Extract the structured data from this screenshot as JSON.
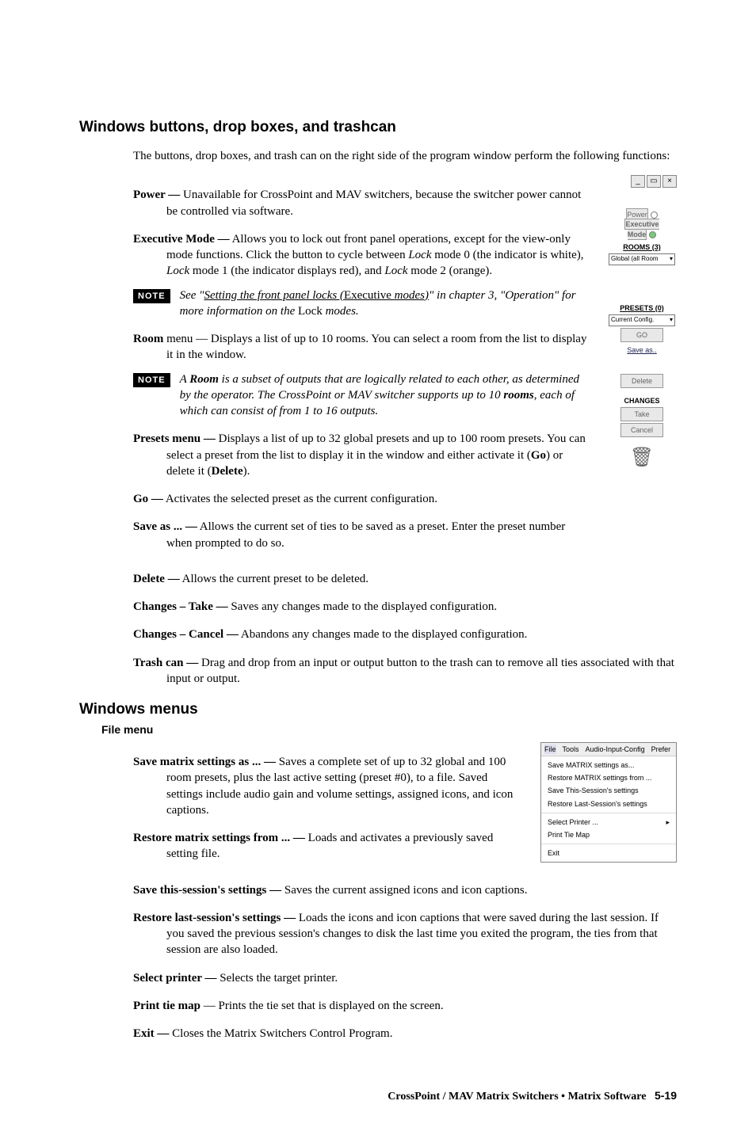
{
  "section1": {
    "heading": "Windows buttons, drop boxes, and trashcan",
    "intro": "The buttons, drop boxes, and trash can on the right side of the program window perform the following functions:",
    "power": {
      "term": "Power —",
      "desc": " Unavailable for CrossPoint and MAV switchers, because the switcher power cannot be controlled via software."
    },
    "exec": {
      "term": "Executive Mode —",
      "a": " Allows you to lock out front panel operations, except for the view-only mode functions.  Click the button to cycle between ",
      "b": "Lock",
      "c": " mode 0 (the indicator is white), ",
      "d": "Lock",
      "e": " mode 1 (the indicator displays red), and ",
      "f": "Lock",
      "g": " mode 2 (orange)."
    },
    "note1": {
      "tag": "NOTE",
      "a": "See \"",
      "link": "Setting the front panel locks (",
      "link_up": "Executive ",
      "link2": "modes)",
      "b": "\" in chapter 3, \"Operation\" for more information on the ",
      "c": "Lock ",
      "d": "modes."
    },
    "room": {
      "term": "Room",
      "a": " menu — Displays a list of up to 10 rooms.  You can select a room from the list to display it in the window."
    },
    "note2": {
      "tag": "NOTE",
      "a": "A ",
      "b": "Room",
      "c": " is a subset of outputs that are logically related to each other, as determined by the operator.  The CrossPoint or MAV switcher supports up to 10 ",
      "d": "rooms",
      "e": ", each of which can consist of from 1 to 16 outputs."
    },
    "presets": {
      "term": "Presets",
      "a": " menu —",
      "b": " Displays a list of up to 32 global presets and up to 100 room presets.  You can select a preset from the list to display it in the window and either activate it (",
      "c": "Go",
      "d": ") or delete it (",
      "e": "Delete",
      "f": ")."
    },
    "go": {
      "term": "Go —",
      "a": " Activates the selected preset as the current configuration."
    },
    "saveas": {
      "term": "Save as ... —",
      "a": " Allows the current set of ties to be saved as a preset.  Enter the preset number when prompted to do so."
    },
    "delete": {
      "term": "Delete —",
      "a": " Allows the current preset to be deleted."
    },
    "take": {
      "term": "Changes – ",
      "term2": "Take —",
      "a": " Saves any changes made to the displayed configuration."
    },
    "cancel": {
      "term": "Changes – ",
      "term2": "Cancel —",
      "a": " Abandons any changes made to the displayed configuration."
    },
    "trash": {
      "term": "Trash can —",
      "a": " Drag and drop from an input or output button to the trash can to remove all ties associated with that input or output."
    }
  },
  "panel": {
    "power": "Power",
    "exec1": "Executive",
    "exec2": "Mode",
    "rooms": "ROOMS (3)",
    "dd1": "Global (all Room",
    "presets": "PRESETS (0)",
    "dd2": "Current Config.",
    "go": "GO",
    "saveas": "Save as..",
    "delete": "Delete",
    "changes": "CHANGES",
    "take": "Take",
    "cancel": "Cancel"
  },
  "section2": {
    "heading": "Windows menus",
    "subhead": "File menu",
    "save_as": {
      "term": "Save matrix settings as ... —",
      "a": " Saves a complete set of up to 32 global and 100 room presets, plus the last active setting (preset #0), to a file.  Saved settings include audio gain and volume settings, assigned icons, and icon captions."
    },
    "restore_from": {
      "term": "Restore matrix settings from ... —",
      "a": " Loads and activates a previously saved setting file."
    },
    "save_sess": {
      "term": "Save this-session's settings —",
      "a": " Saves the current assigned icons and icon captions."
    },
    "restore_sess": {
      "term": "Restore last-session's settings —",
      "a": " Loads the icons and icon captions that were saved during the last session.  If you saved the previous session's changes to disk the last time you exited the program, the ties from that session are also loaded."
    },
    "printer": {
      "term": "Select printer —",
      "a": " Selects the target printer."
    },
    "printmap": {
      "term": "Print tie map",
      "a": " — Prints the tie set that is displayed on the screen."
    },
    "exit": {
      "term": "Exit —",
      "a": " Closes the Matrix Switchers Control Program."
    }
  },
  "filemenu": {
    "m1": "File",
    "m2": "Tools",
    "m3": "Audio-Input-Config",
    "m4": "Prefer",
    "i1": "Save MATRIX settings as...",
    "i2": "Restore MATRIX settings from ...",
    "i3": "Save This-Session's settings",
    "i4": "Restore Last-Session's settings",
    "i5": "Select Printer ...",
    "i6": "Print Tie Map",
    "i7": "Exit"
  },
  "footer": {
    "a": "CrossPoint / MAV Matrix Switchers • Matrix Software",
    "pg": "5-19"
  }
}
